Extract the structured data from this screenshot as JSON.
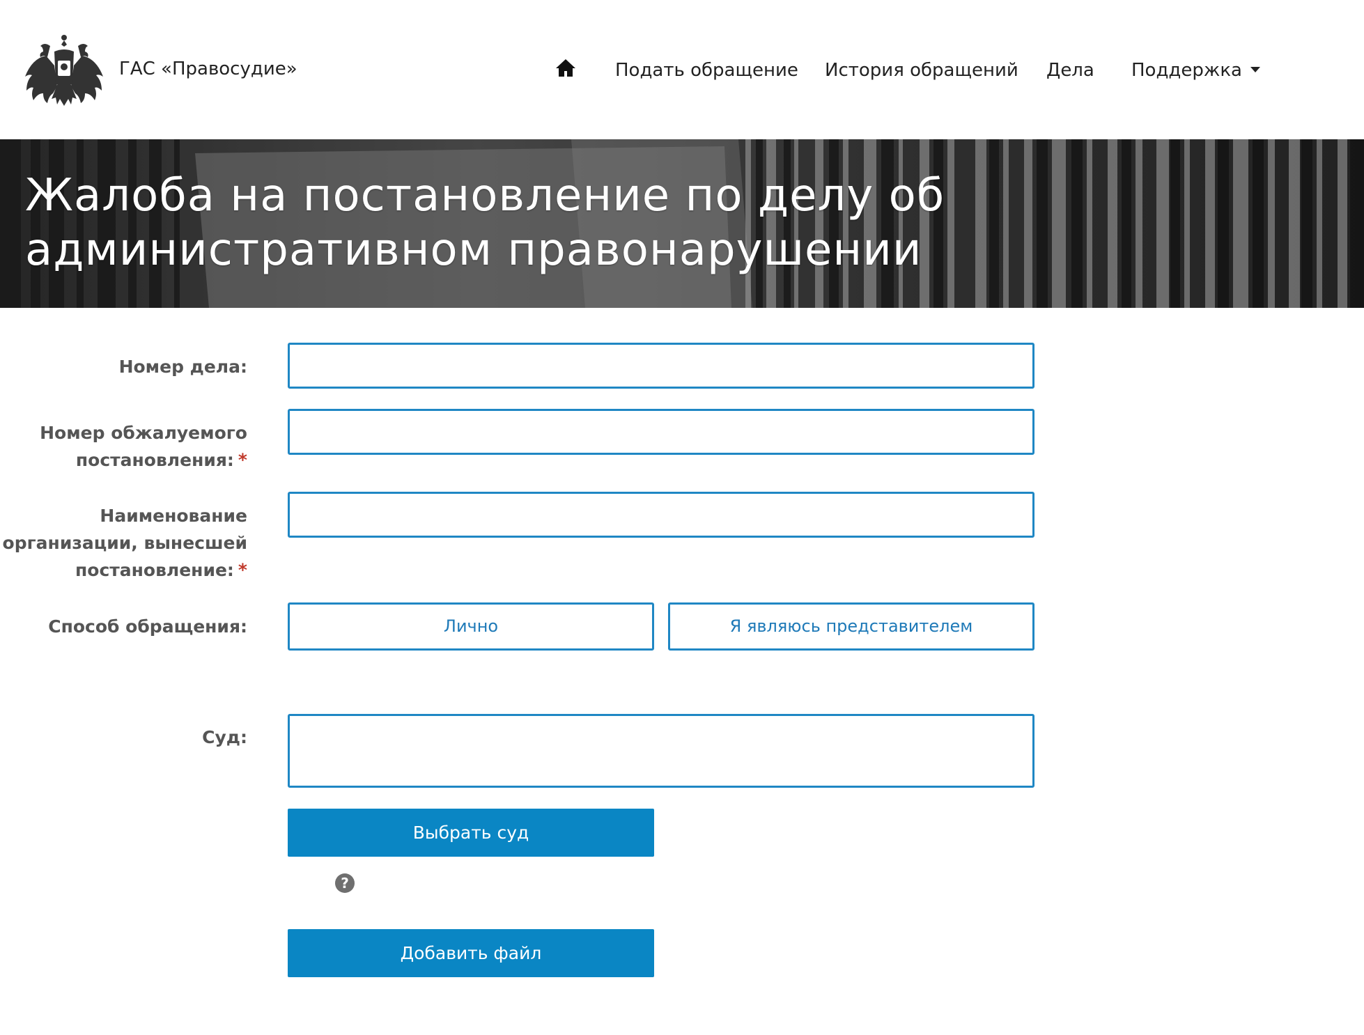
{
  "header": {
    "site_title": "ГАС «Правосудие»",
    "logo_icon": "coat-of-arms-icon",
    "home_icon": "home-icon",
    "nav": [
      {
        "label": "Подать обращение"
      },
      {
        "label": "История обращений"
      },
      {
        "label": "Дела"
      },
      {
        "label": "Поддержка"
      }
    ]
  },
  "banner": {
    "title": "Жалоба на постановление по делу об административном правонарушении"
  },
  "form": {
    "case_number": {
      "label": "Номер дела:",
      "value": ""
    },
    "ruling_number": {
      "label": "Номер обжалуемого постановления:",
      "required": "*",
      "value": ""
    },
    "organization": {
      "label": "Наименование организации, вынесшей постановление:",
      "required": "*",
      "value": ""
    },
    "appeal_mode": {
      "label": "Способ обращения:",
      "options": [
        "Лично",
        "Я являюсь представителем"
      ]
    },
    "court": {
      "label": "Суд:",
      "value": ""
    },
    "select_court_button": "Выбрать суд",
    "help_icon": "question-circle-icon",
    "add_file_button": "Добавить файл"
  },
  "colors": {
    "accent": "#0a86c4",
    "border": "#1f87c4",
    "label": "#555555",
    "required": "#c0392b"
  }
}
